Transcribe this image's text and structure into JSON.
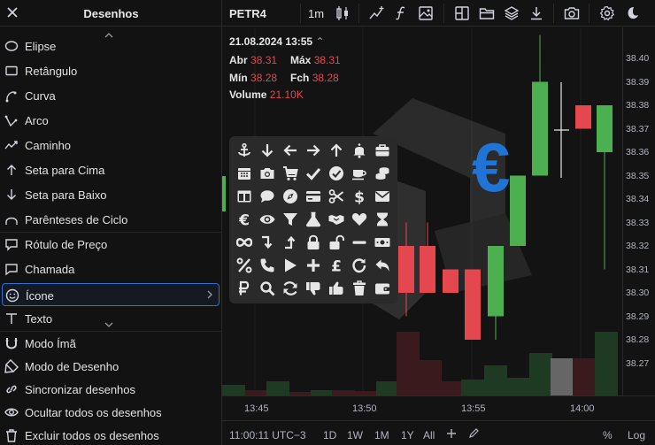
{
  "sidebar": {
    "title": "Desenhos",
    "items": [
      {
        "label": "Elipse",
        "icon": "ellipse-icon"
      },
      {
        "label": "Retângulo",
        "icon": "rectangle-icon"
      },
      {
        "label": "Curva",
        "icon": "curve-icon"
      },
      {
        "label": "Arco",
        "icon": "arc-icon"
      },
      {
        "label": "Caminho",
        "icon": "path-icon"
      },
      {
        "label": "Seta para Cima",
        "icon": "arrow-up-icon"
      },
      {
        "label": "Seta para Baixo",
        "icon": "arrow-down-icon"
      },
      {
        "label": "Parênteses de Ciclo",
        "icon": "cycle-brackets-icon"
      },
      {
        "label": "Rótulo de Preço",
        "icon": "price-label-icon"
      },
      {
        "label": "Chamada",
        "icon": "callout-icon"
      },
      {
        "label": "Ícone",
        "icon": "smiley-icon",
        "selected": true
      },
      {
        "label": "Texto",
        "icon": "text-icon"
      },
      {
        "label": "Modo Ímã",
        "icon": "magnet-icon"
      },
      {
        "label": "Modo de Desenho",
        "icon": "draw-mode-icon"
      },
      {
        "label": "Sincronizar desenhos",
        "icon": "link-icon"
      },
      {
        "label": "Ocultar todos os desenhos",
        "icon": "eye-icon"
      },
      {
        "label": "Excluir todos os desenhos",
        "icon": "trash-icon"
      }
    ]
  },
  "toolbar": {
    "symbol": "PETR4",
    "interval": "1m",
    "buttons": [
      "candles-icon",
      "indicators-icon",
      "function-icon",
      "image-icon",
      "layout-icon",
      "folder-icon",
      "layers-icon",
      "download-icon",
      "camera-icon",
      "settings-icon",
      "theme-moon-icon"
    ]
  },
  "legend": {
    "date": "21.08.2024 13:55",
    "open_label": "Abr",
    "open": "38.31",
    "high_label": "Máx",
    "high": "38.31",
    "low_label": "Mín",
    "low": "38.28",
    "close_label": "Fch",
    "close": "38.28",
    "volume_label": "Volume",
    "volume": "21.10K"
  },
  "price_axis": [
    "38.40",
    "38.39",
    "38.38",
    "38.37",
    "38.36",
    "38.35",
    "38.34",
    "38.33",
    "38.32",
    "38.31",
    "38.30",
    "38.29",
    "38.28",
    "38.27"
  ],
  "time_axis": [
    "13:45",
    "13:50",
    "13:55",
    "14:00"
  ],
  "icon_picker": {
    "icons": [
      "anchor-icon",
      "arrow-down-icon",
      "arrow-left-icon",
      "arrow-right-icon",
      "arrow-up-icon",
      "bell-icon",
      "briefcase-icon",
      "calendar-icon",
      "camera-icon",
      "cart-icon",
      "check-icon",
      "check-circle-icon",
      "coffee-icon",
      "coins-icon",
      "table-icon",
      "comment-icon",
      "compass-icon",
      "credit-card-icon",
      "scissors-icon",
      "dollar-icon",
      "envelope-icon",
      "euro-icon",
      "eye-icon",
      "filter-icon",
      "flask-icon",
      "handshake-icon",
      "heart-icon",
      "hourglass-icon",
      "infinity-icon",
      "level-down-icon",
      "level-up-icon",
      "lock-icon",
      "unlock-icon",
      "minus-icon",
      "money-bill-icon",
      "percent-icon",
      "phone-icon",
      "play-icon",
      "plus-icon",
      "pound-icon",
      "redo-icon",
      "reply-icon",
      "ruble-icon",
      "search-icon",
      "sync-icon",
      "thumbs-down-icon",
      "thumbs-up-icon",
      "trash-icon",
      "wallet-icon"
    ]
  },
  "bottombar": {
    "clock": "11:00:11 UTC−3",
    "ranges": [
      "1D",
      "1W",
      "1M",
      "1Y",
      "All"
    ],
    "percent": "%",
    "log": "Log"
  },
  "colors": {
    "up": "#4caf50",
    "down": "#e5474f",
    "accent": "#2f6fd6",
    "background": "#131313"
  }
}
